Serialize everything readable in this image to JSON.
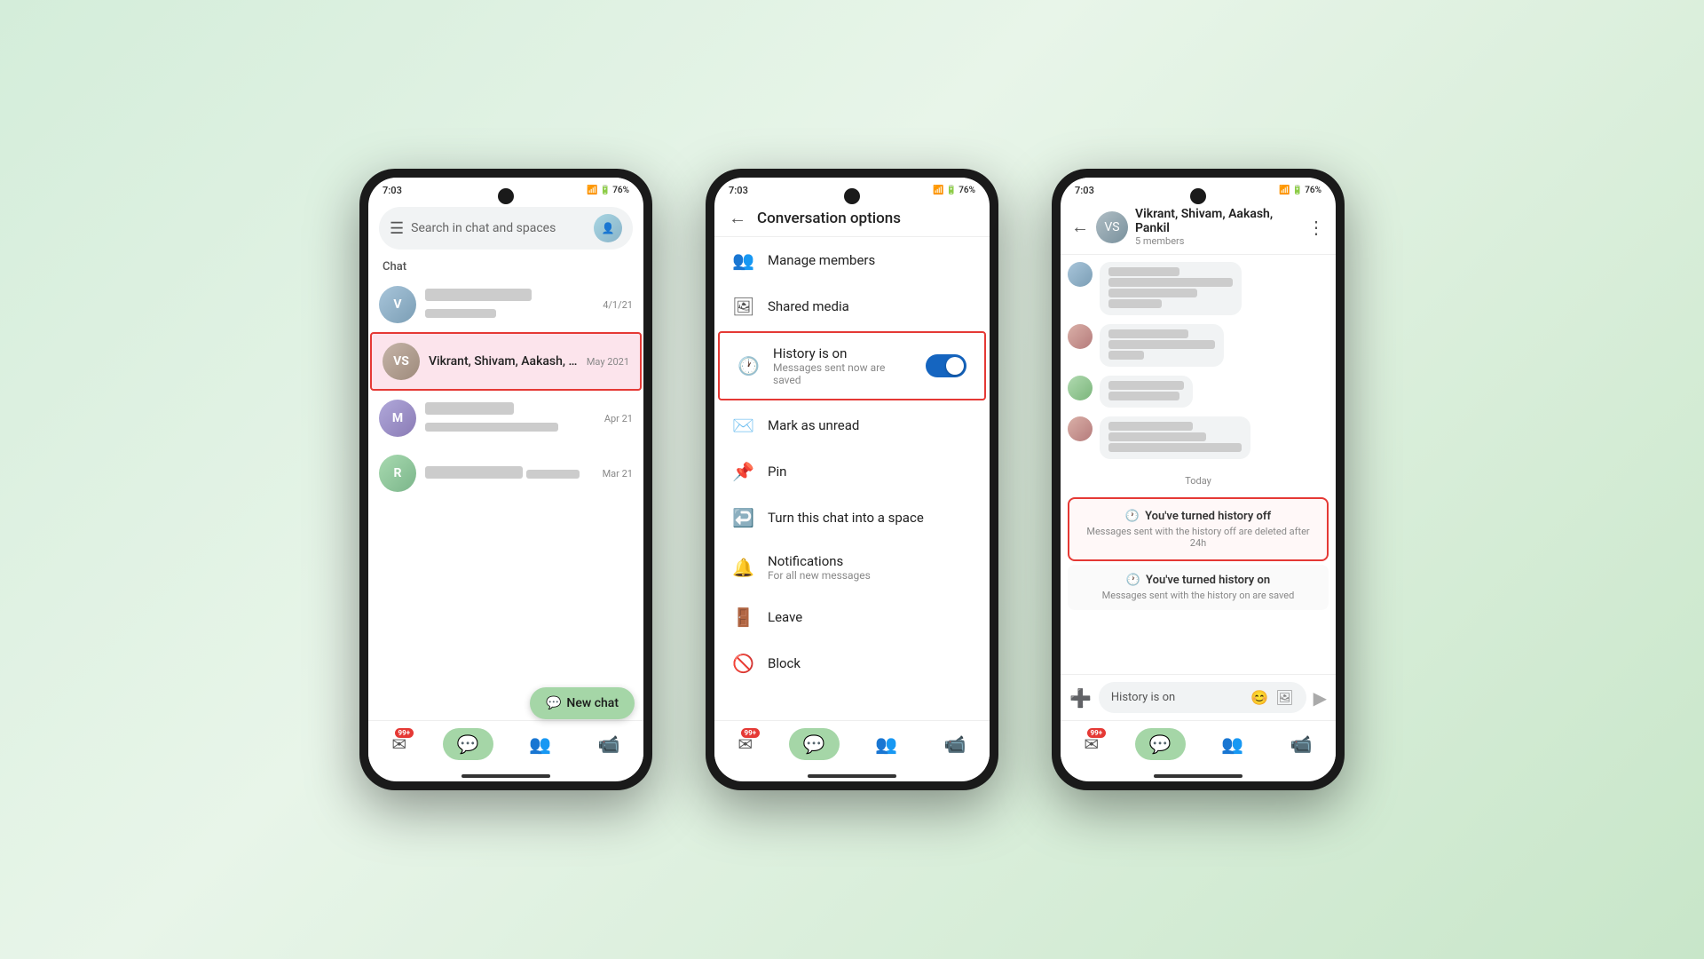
{
  "phone1": {
    "status_time": "7:03",
    "search_placeholder": "Search in chat and spaces",
    "section_label": "Chat",
    "chat_items": [
      {
        "id": 1,
        "name": "Blurred Name 1",
        "preview": "last message",
        "time": "4/1/21",
        "selected": false
      },
      {
        "id": 2,
        "name": "Vikrant, Shivam, Aakash, ...",
        "preview": "",
        "time": "May 2021",
        "selected": true
      },
      {
        "id": 3,
        "name": "Blurred Name 3",
        "preview": "blurred preview text here",
        "time": "Apr 21",
        "selected": false
      },
      {
        "id": 4,
        "name": "Blurred Name 4",
        "preview": "blurred",
        "time": "Mar 21",
        "selected": false
      }
    ],
    "new_chat_label": "New chat",
    "nav_items": [
      "mail",
      "chat",
      "people",
      "video"
    ],
    "badge_count": "99+"
  },
  "phone2": {
    "status_time": "7:03",
    "title": "Conversation options",
    "options": [
      {
        "id": "manage",
        "icon": "👥",
        "title": "Manage members",
        "subtitle": "",
        "highlighted": false
      },
      {
        "id": "media",
        "icon": "🖼",
        "title": "Shared media",
        "subtitle": "",
        "highlighted": false
      },
      {
        "id": "history",
        "icon": "🕐",
        "title": "History is on",
        "subtitle": "Messages sent now are saved",
        "highlighted": true,
        "toggle": true
      },
      {
        "id": "unread",
        "icon": "✉️",
        "title": "Mark as unread",
        "subtitle": "",
        "highlighted": false
      },
      {
        "id": "pin",
        "icon": "🔔",
        "title": "Pin",
        "subtitle": "",
        "highlighted": false
      },
      {
        "id": "space",
        "icon": "↩️",
        "title": "Turn this chat into a space",
        "subtitle": "",
        "highlighted": false
      },
      {
        "id": "notifications",
        "icon": "🔕",
        "title": "Notifications",
        "subtitle": "For all new messages",
        "highlighted": false
      },
      {
        "id": "leave",
        "icon": "🚪",
        "title": "Leave",
        "subtitle": "",
        "highlighted": false
      },
      {
        "id": "block",
        "icon": "🚫",
        "title": "Block",
        "subtitle": "",
        "highlighted": false
      }
    ],
    "badge_count": "99+"
  },
  "phone3": {
    "status_time": "7:03",
    "chat_name": "Vikrant, Shivam, Aakash, Pankil",
    "members": "5 members",
    "date_today": "Today",
    "history_off_title": "You've turned history off",
    "history_off_sub": "Messages sent with the history off are deleted after 24h",
    "history_on_title": "You've turned history on",
    "history_on_sub": "Messages sent with the history on are saved",
    "input_placeholder": "History is on",
    "badge_count": "99+"
  }
}
